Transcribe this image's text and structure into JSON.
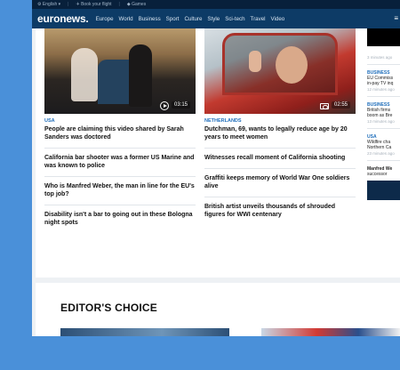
{
  "topbar": {
    "language": "⚙ English ▾",
    "flight": "✈ Book your flight",
    "games": "◆ Games"
  },
  "nav": {
    "logo": "euronews.",
    "items": [
      "Europe",
      "World",
      "Business",
      "Sport",
      "Culture",
      "Style",
      "Sci-tech",
      "Travel",
      "Video"
    ],
    "menu_icon": "≡"
  },
  "articles": {
    "col1": {
      "duration": "03:15",
      "tag": "USA",
      "headline": "People are claiming this video shared by Sarah Sanders was doctored",
      "items": [
        "California bar shooter was a former US Marine and was known to police",
        "Who is Manfred Weber, the man in line for the EU's top job?",
        "Disability isn't a bar to going out in these Bologna night spots"
      ]
    },
    "col2": {
      "duration": "02:55",
      "tag": "NETHERLANDS",
      "headline": "Dutchman, 69, wants to legally reduce age by 20 years to meet women",
      "items": [
        "Witnesses recall moment of California shooting",
        "Graffiti keeps memory of World War One soldiers alive",
        "British artist unveils thousands of shrouded figures for WWI centenary"
      ]
    }
  },
  "sidebar": {
    "ts0": "3 minutes ago",
    "cat1": "BUSINESS",
    "text1a": "EU Commiss",
    "text1b": "in-pay TV inq",
    "ts1": "12 minutes ago",
    "cat2": "BUSINESS",
    "text2a": "British firms",
    "text2b": "boom as Bre",
    "ts2": "13 minutes ago",
    "cat3": "USA",
    "text3a": "Wildfire cha",
    "text3b": "Northern Ca",
    "ts3": "23 minutes ago",
    "bold1": "Manfred We",
    "bold2": "successor"
  },
  "editors_choice": {
    "title": "EDITOR'S CHOICE"
  }
}
